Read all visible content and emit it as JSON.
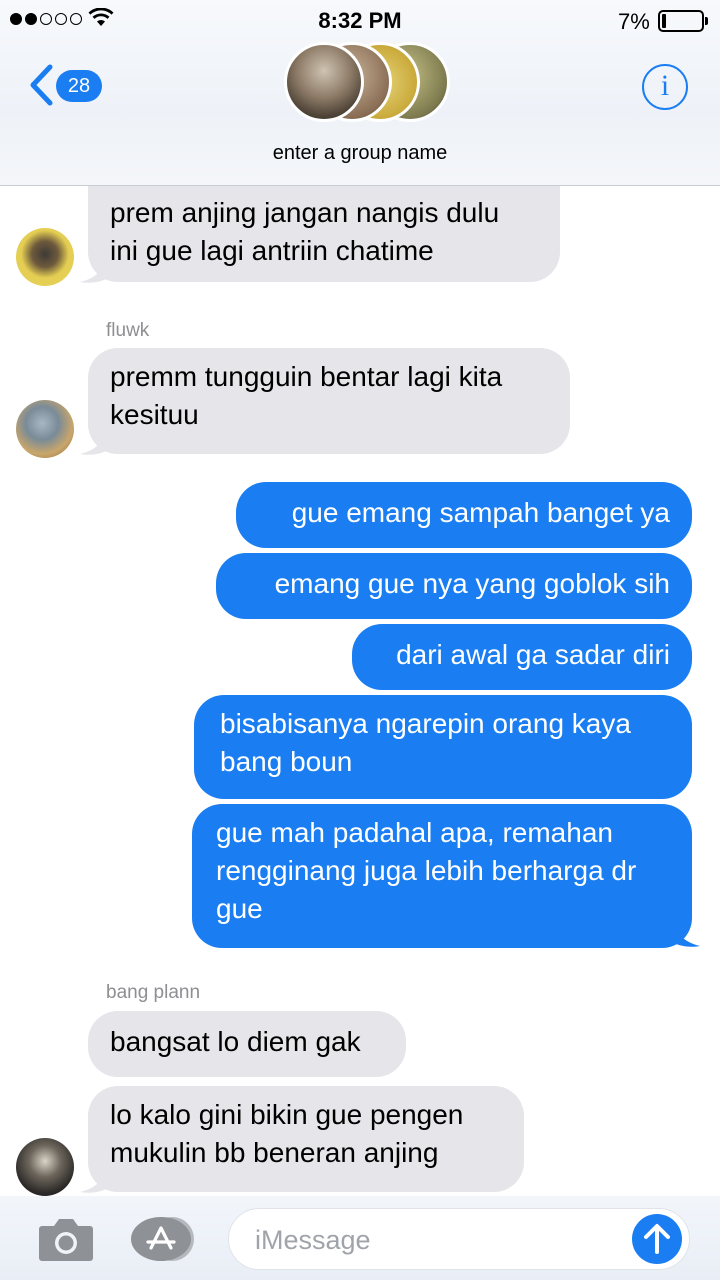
{
  "status_bar": {
    "time": "8:32 PM",
    "battery_percent": "7%",
    "signal_bars_filled": 2,
    "signal_bars_total": 5
  },
  "nav": {
    "back_badge": "28",
    "group_name_placeholder": "enter a group name",
    "info_label": "i"
  },
  "messages": [
    {
      "direction": "incoming",
      "lines": [
        "prem anjing jangan nangis dulu",
        "ini gue lagi antriin chatime"
      ]
    },
    {
      "direction": "incoming",
      "sender": "fluwk",
      "lines": [
        "premm tungguin bentar lagi kita",
        "kesituu"
      ]
    },
    {
      "direction": "outgoing",
      "lines": [
        "gue emang sampah banget ya"
      ]
    },
    {
      "direction": "outgoing",
      "lines": [
        "emang gue nya yang goblok sih"
      ]
    },
    {
      "direction": "outgoing",
      "lines": [
        "dari awal ga sadar diri"
      ]
    },
    {
      "direction": "outgoing",
      "lines": [
        "bisabisanya ngarepin orang kaya",
        "bang boun"
      ]
    },
    {
      "direction": "outgoing",
      "lines": [
        "gue mah padahal apa, remahan",
        "rengginang juga lebih berharga dr",
        "gue"
      ]
    },
    {
      "direction": "incoming",
      "sender": "bang plann",
      "lines": [
        "bangsat lo diem gak"
      ]
    },
    {
      "direction": "incoming",
      "lines": [
        "lo kalo gini bikin gue pengen",
        "mukulin bb beneran anjing"
      ]
    }
  ],
  "composer": {
    "placeholder": "iMessage"
  },
  "colors": {
    "accent": "#1a7ef2",
    "incoming_bubble": "#e5e5ea",
    "sender_label": "#8e8e93"
  },
  "icons": [
    "back-chevron-icon",
    "info-icon",
    "camera-icon",
    "app-store-icon",
    "send-arrow-icon",
    "wifi-icon",
    "battery-icon"
  ]
}
